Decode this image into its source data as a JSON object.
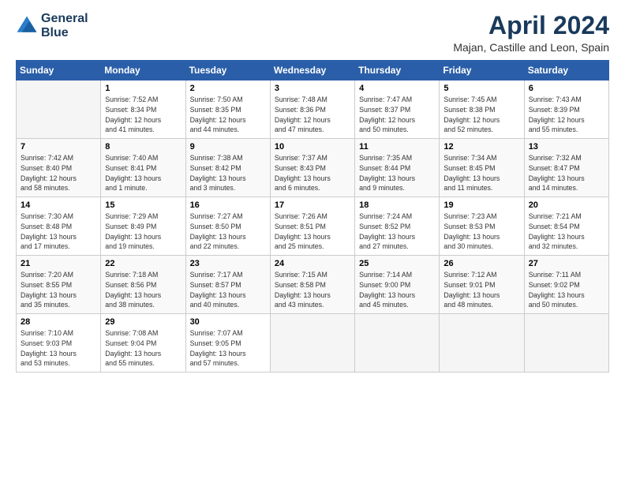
{
  "header": {
    "logo_line1": "General",
    "logo_line2": "Blue",
    "title": "April 2024",
    "subtitle": "Majan, Castille and Leon, Spain"
  },
  "weekdays": [
    "Sunday",
    "Monday",
    "Tuesday",
    "Wednesday",
    "Thursday",
    "Friday",
    "Saturday"
  ],
  "weeks": [
    [
      {
        "num": "",
        "info": ""
      },
      {
        "num": "1",
        "info": "Sunrise: 7:52 AM\nSunset: 8:34 PM\nDaylight: 12 hours\nand 41 minutes."
      },
      {
        "num": "2",
        "info": "Sunrise: 7:50 AM\nSunset: 8:35 PM\nDaylight: 12 hours\nand 44 minutes."
      },
      {
        "num": "3",
        "info": "Sunrise: 7:48 AM\nSunset: 8:36 PM\nDaylight: 12 hours\nand 47 minutes."
      },
      {
        "num": "4",
        "info": "Sunrise: 7:47 AM\nSunset: 8:37 PM\nDaylight: 12 hours\nand 50 minutes."
      },
      {
        "num": "5",
        "info": "Sunrise: 7:45 AM\nSunset: 8:38 PM\nDaylight: 12 hours\nand 52 minutes."
      },
      {
        "num": "6",
        "info": "Sunrise: 7:43 AM\nSunset: 8:39 PM\nDaylight: 12 hours\nand 55 minutes."
      }
    ],
    [
      {
        "num": "7",
        "info": "Sunrise: 7:42 AM\nSunset: 8:40 PM\nDaylight: 12 hours\nand 58 minutes."
      },
      {
        "num": "8",
        "info": "Sunrise: 7:40 AM\nSunset: 8:41 PM\nDaylight: 13 hours\nand 1 minute."
      },
      {
        "num": "9",
        "info": "Sunrise: 7:38 AM\nSunset: 8:42 PM\nDaylight: 13 hours\nand 3 minutes."
      },
      {
        "num": "10",
        "info": "Sunrise: 7:37 AM\nSunset: 8:43 PM\nDaylight: 13 hours\nand 6 minutes."
      },
      {
        "num": "11",
        "info": "Sunrise: 7:35 AM\nSunset: 8:44 PM\nDaylight: 13 hours\nand 9 minutes."
      },
      {
        "num": "12",
        "info": "Sunrise: 7:34 AM\nSunset: 8:45 PM\nDaylight: 13 hours\nand 11 minutes."
      },
      {
        "num": "13",
        "info": "Sunrise: 7:32 AM\nSunset: 8:47 PM\nDaylight: 13 hours\nand 14 minutes."
      }
    ],
    [
      {
        "num": "14",
        "info": "Sunrise: 7:30 AM\nSunset: 8:48 PM\nDaylight: 13 hours\nand 17 minutes."
      },
      {
        "num": "15",
        "info": "Sunrise: 7:29 AM\nSunset: 8:49 PM\nDaylight: 13 hours\nand 19 minutes."
      },
      {
        "num": "16",
        "info": "Sunrise: 7:27 AM\nSunset: 8:50 PM\nDaylight: 13 hours\nand 22 minutes."
      },
      {
        "num": "17",
        "info": "Sunrise: 7:26 AM\nSunset: 8:51 PM\nDaylight: 13 hours\nand 25 minutes."
      },
      {
        "num": "18",
        "info": "Sunrise: 7:24 AM\nSunset: 8:52 PM\nDaylight: 13 hours\nand 27 minutes."
      },
      {
        "num": "19",
        "info": "Sunrise: 7:23 AM\nSunset: 8:53 PM\nDaylight: 13 hours\nand 30 minutes."
      },
      {
        "num": "20",
        "info": "Sunrise: 7:21 AM\nSunset: 8:54 PM\nDaylight: 13 hours\nand 32 minutes."
      }
    ],
    [
      {
        "num": "21",
        "info": "Sunrise: 7:20 AM\nSunset: 8:55 PM\nDaylight: 13 hours\nand 35 minutes."
      },
      {
        "num": "22",
        "info": "Sunrise: 7:18 AM\nSunset: 8:56 PM\nDaylight: 13 hours\nand 38 minutes."
      },
      {
        "num": "23",
        "info": "Sunrise: 7:17 AM\nSunset: 8:57 PM\nDaylight: 13 hours\nand 40 minutes."
      },
      {
        "num": "24",
        "info": "Sunrise: 7:15 AM\nSunset: 8:58 PM\nDaylight: 13 hours\nand 43 minutes."
      },
      {
        "num": "25",
        "info": "Sunrise: 7:14 AM\nSunset: 9:00 PM\nDaylight: 13 hours\nand 45 minutes."
      },
      {
        "num": "26",
        "info": "Sunrise: 7:12 AM\nSunset: 9:01 PM\nDaylight: 13 hours\nand 48 minutes."
      },
      {
        "num": "27",
        "info": "Sunrise: 7:11 AM\nSunset: 9:02 PM\nDaylight: 13 hours\nand 50 minutes."
      }
    ],
    [
      {
        "num": "28",
        "info": "Sunrise: 7:10 AM\nSunset: 9:03 PM\nDaylight: 13 hours\nand 53 minutes."
      },
      {
        "num": "29",
        "info": "Sunrise: 7:08 AM\nSunset: 9:04 PM\nDaylight: 13 hours\nand 55 minutes."
      },
      {
        "num": "30",
        "info": "Sunrise: 7:07 AM\nSunset: 9:05 PM\nDaylight: 13 hours\nand 57 minutes."
      },
      {
        "num": "",
        "info": ""
      },
      {
        "num": "",
        "info": ""
      },
      {
        "num": "",
        "info": ""
      },
      {
        "num": "",
        "info": ""
      }
    ]
  ]
}
